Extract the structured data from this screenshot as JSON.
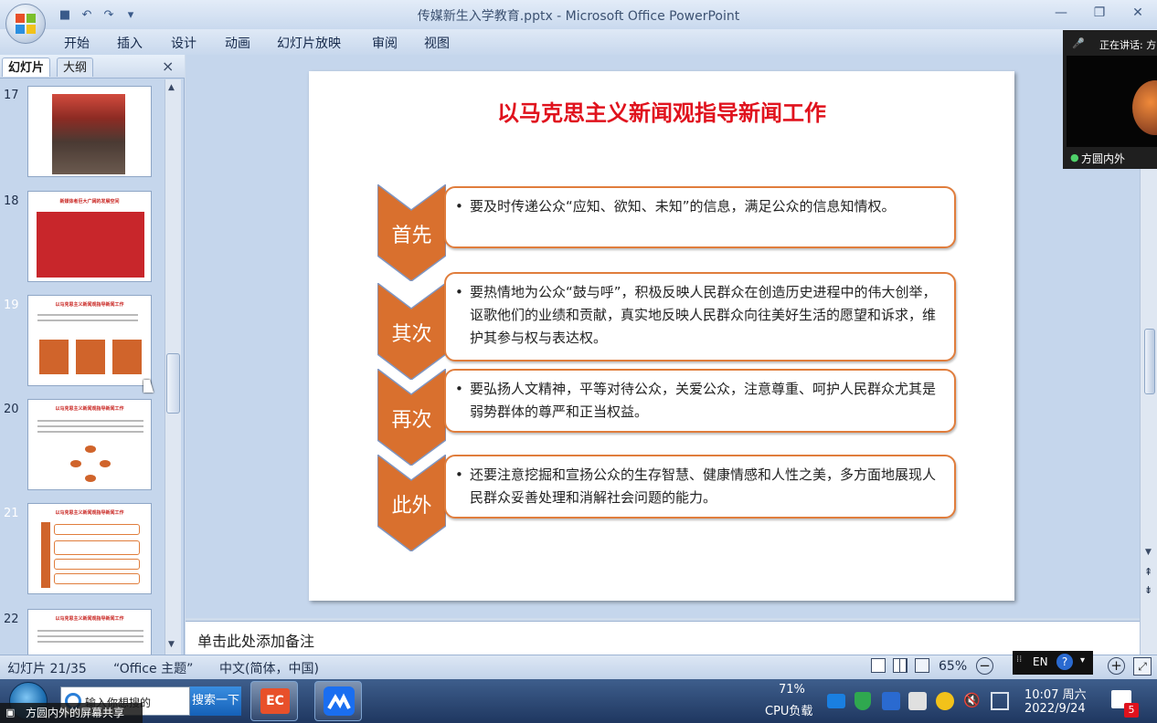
{
  "window": {
    "title": "传媒新生入学教育.pptx - Microsoft Office PowerPoint"
  },
  "ribbon_tabs": [
    "开始",
    "插入",
    "设计",
    "动画",
    "幻灯片放映",
    "审阅",
    "视图"
  ],
  "panel": {
    "tab_slides": "幻灯片",
    "tab_outline": "大纲",
    "close": "×"
  },
  "thumbnails": [
    {
      "num": "17",
      "title": ""
    },
    {
      "num": "18",
      "title": "新媒体者巨大广阔的发展空间"
    },
    {
      "num": "19",
      "title": "以马克思主义新闻观指导新闻工作"
    },
    {
      "num": "20",
      "title": "以马克思主义新闻观指导新闻工作"
    },
    {
      "num": "21",
      "title": "以马克思主义新闻观指导新闻工作"
    },
    {
      "num": "22",
      "title": "以马克思主义新闻观指导新闻工作"
    }
  ],
  "slide": {
    "title": "以马克思主义新闻观指导新闻工作",
    "items": [
      {
        "label": "首先",
        "text": "要及时传递公众“应知、欲知、未知”的信息，满足公众的信息知情权。"
      },
      {
        "label": "其次",
        "text": "要热情地为公众“鼓与呼”，积极反映人民群众在创造历史进程中的伟大创举，讴歌他们的业绩和贡献，真实地反映人民群众向往美好生活的愿望和诉求，维护其参与权与表达权。"
      },
      {
        "label": "再次",
        "text": "要弘扬人文精神，平等对待公众，关爱公众，注意尊重、呵护人民群众尤其是弱势群体的尊严和正当权益。"
      },
      {
        "label": "此外",
        "text": "还要注意挖掘和宣扬公众的生存智慧、健康情感和人性之美，多方面地展现人民群众妥善处理和消解社会问题的能力。"
      }
    ]
  },
  "notes": {
    "placeholder": "单击此处添加备注"
  },
  "status": {
    "slide_pos": "幻灯片 21/35",
    "theme": "“Office 主题”",
    "language": "中文(简体，中国)",
    "zoom": "65%"
  },
  "taskbar": {
    "search_placeholder": "输入你想搜的",
    "search_button": "搜索一下",
    "cpu_value": "71%",
    "cpu_label": "CPU负载",
    "time": "10:07 周六",
    "date": "2022/9/24",
    "badge": "5"
  },
  "meeting": {
    "speaking": "正在讲话: 方",
    "participant": "方圆内外",
    "share_label": "方圆内外的屏幕共享"
  },
  "ime": {
    "lang": "EN"
  },
  "colors": {
    "accent_orange": "#d9702e",
    "title_red": "#e0121d"
  }
}
